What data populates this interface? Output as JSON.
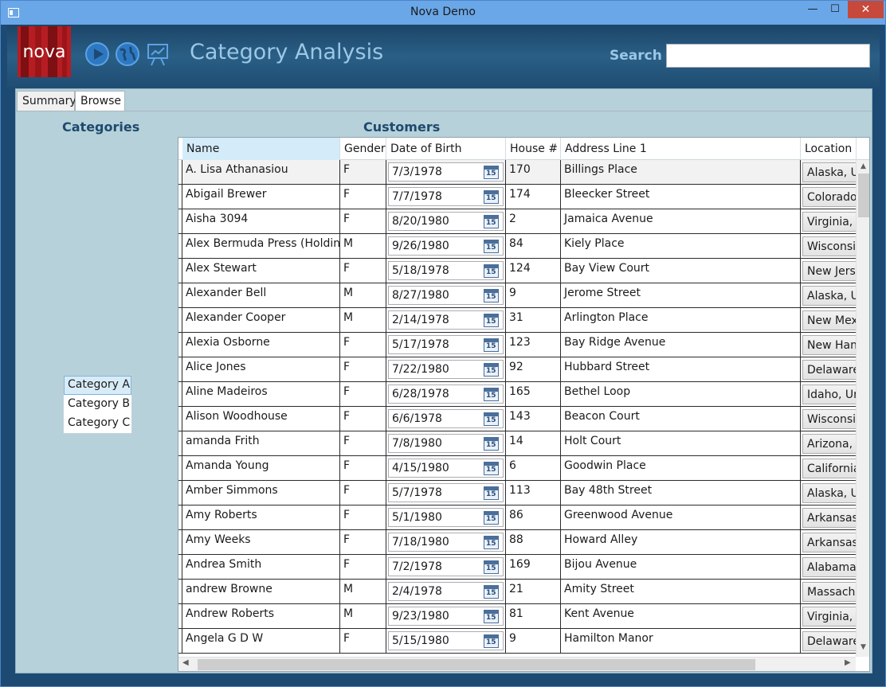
{
  "window": {
    "title": "Nova Demo",
    "min": "—",
    "max": "☐",
    "close": "✕"
  },
  "header": {
    "logo_text": "nova",
    "icons": [
      "play-icon",
      "globe-icon",
      "presentation-icon"
    ],
    "title": "Category Analysis",
    "search_label": "Search",
    "search_value": ""
  },
  "tabs": [
    {
      "label": "Summary"
    },
    {
      "label": "Browse"
    }
  ],
  "categories": {
    "title": "Categories",
    "items": [
      "Category A",
      "Category B",
      "Category C"
    ],
    "selected": "Category A"
  },
  "customers": {
    "title": "Customers",
    "columns": [
      "Name",
      "Gender",
      "Date of Birth",
      "House #",
      "Address Line 1",
      "Location"
    ],
    "rows": [
      [
        "A. Lisa Athanasiou",
        "F",
        "7/3/1978",
        "170",
        "Billings Place",
        "Alaska, U"
      ],
      [
        "Abigail Brewer",
        "F",
        "7/7/1978",
        "174",
        "Bleecker Street",
        "Colorado"
      ],
      [
        "Aisha  3094",
        "F",
        "8/20/1980",
        "2",
        "Jamaica Avenue",
        "Virginia, "
      ],
      [
        "Alex Bermuda Press (Holdings",
        "M",
        "9/26/1980",
        "84",
        "Kiely Place",
        "Wisconsi"
      ],
      [
        "Alex Stewart",
        "F",
        "5/18/1978",
        "124",
        "Bay View Court",
        "New Jers"
      ],
      [
        "Alexander Bell",
        "M",
        "8/27/1980",
        "9",
        "Jerome Street",
        "Alaska, U"
      ],
      [
        "Alexander Cooper",
        "M",
        "2/14/1978",
        "31",
        "Arlington Place",
        "New Mex"
      ],
      [
        "Alexia Osborne",
        "F",
        "5/17/1978",
        "123",
        "Bay Ridge Avenue",
        "New Han"
      ],
      [
        "Alice Jones",
        "F",
        "7/22/1980",
        "92",
        "Hubbard Street",
        "Delaware"
      ],
      [
        "Aline Madeiros",
        "F",
        "6/28/1978",
        "165",
        "Bethel Loop",
        "Idaho, Ur"
      ],
      [
        "Alison Woodhouse",
        "F",
        "6/6/1978",
        "143",
        "Beacon Court",
        "Wisconsi"
      ],
      [
        "amanda Frith",
        "F",
        "7/8/1980",
        "14",
        "Holt Court",
        "Arizona, "
      ],
      [
        "Amanda Young",
        "F",
        "4/15/1980",
        "6",
        "Goodwin Place",
        "California"
      ],
      [
        "Amber Simmons",
        "F",
        "5/7/1978",
        "113",
        "Bay 48th Street",
        "Alaska, U"
      ],
      [
        "Amy Roberts",
        "F",
        "5/1/1980",
        "86",
        "Greenwood Avenue",
        "Arkansas"
      ],
      [
        "Amy Weeks",
        "F",
        "7/18/1980",
        "88",
        "Howard Alley",
        "Arkansas"
      ],
      [
        "Andrea Smith",
        "F",
        "7/2/1978",
        "169",
        "Bijou Avenue",
        "Alabama,"
      ],
      [
        "andrew Browne",
        "M",
        "2/4/1978",
        "21",
        "Amity Street",
        "Massachu"
      ],
      [
        "Andrew Roberts",
        "M",
        "9/23/1980",
        "81",
        "Kent Avenue",
        "Virginia, "
      ],
      [
        "Angela G D W",
        "F",
        "5/15/1980",
        "9",
        "Hamilton Manor",
        "Delaware"
      ]
    ]
  },
  "calendar_glyph": "15"
}
